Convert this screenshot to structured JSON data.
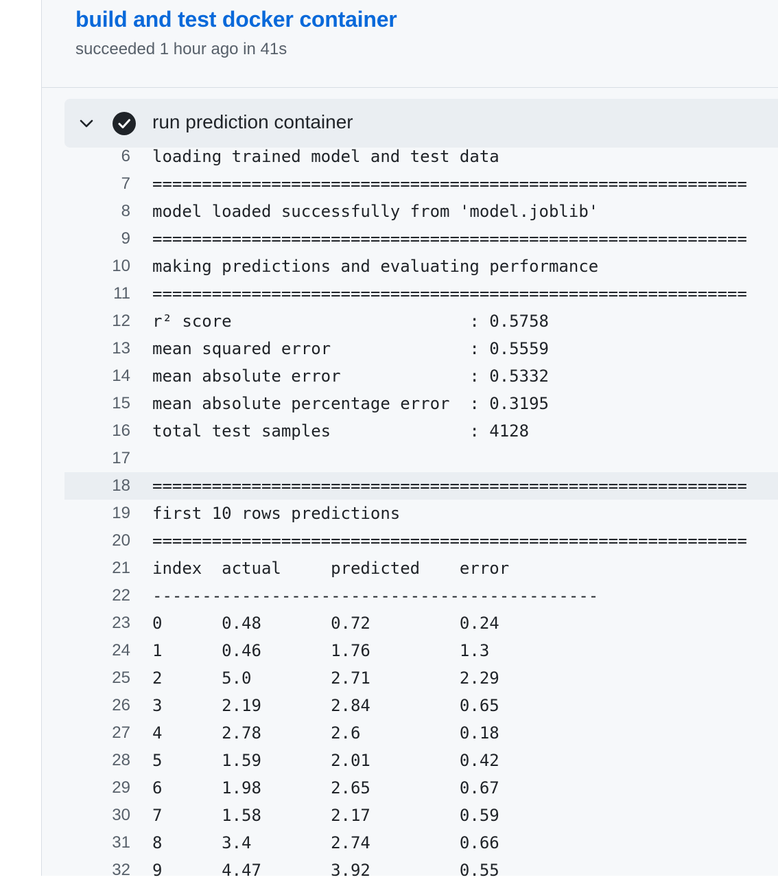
{
  "job": {
    "title": "build and test docker container",
    "status": "succeeded 1 hour ago in 41s"
  },
  "step": {
    "title": "run prediction container",
    "icons": {
      "toggle": "chevron-down-icon",
      "status": "check-circle-icon"
    },
    "status_color": "#1f2328"
  },
  "colors": {
    "link": "#0969da",
    "muted": "#57606a",
    "text": "#1f2328",
    "panel_bg": "#f6f8fa",
    "highlight_bg": "#eaeef2"
  },
  "log": {
    "highlighted_line": "18",
    "lines": [
      {
        "no": "6",
        "text": "loading trained model and test data"
      },
      {
        "no": "7",
        "text": "============================================================"
      },
      {
        "no": "8",
        "text": "model loaded successfully from 'model.joblib'"
      },
      {
        "no": "9",
        "text": "============================================================"
      },
      {
        "no": "10",
        "text": "making predictions and evaluating performance"
      },
      {
        "no": "11",
        "text": "============================================================"
      },
      {
        "no": "12",
        "text": "r² score                        : 0.5758"
      },
      {
        "no": "13",
        "text": "mean squared error              : 0.5559"
      },
      {
        "no": "14",
        "text": "mean absolute error             : 0.5332"
      },
      {
        "no": "15",
        "text": "mean absolute percentage error  : 0.3195"
      },
      {
        "no": "16",
        "text": "total test samples              : 4128"
      },
      {
        "no": "17",
        "text": ""
      },
      {
        "no": "18",
        "text": "============================================================"
      },
      {
        "no": "19",
        "text": "first 10 rows predictions"
      },
      {
        "no": "20",
        "text": "============================================================"
      },
      {
        "no": "21",
        "text": "index  actual     predicted    error"
      },
      {
        "no": "22",
        "text": "---------------------------------------------"
      },
      {
        "no": "23",
        "text": "0      0.48       0.72         0.24"
      },
      {
        "no": "24",
        "text": "1      0.46       1.76         1.3"
      },
      {
        "no": "25",
        "text": "2      5.0        2.71         2.29"
      },
      {
        "no": "26",
        "text": "3      2.19       2.84         0.65"
      },
      {
        "no": "27",
        "text": "4      2.78       2.6          0.18"
      },
      {
        "no": "28",
        "text": "5      1.59       2.01         0.42"
      },
      {
        "no": "29",
        "text": "6      1.98       2.65         0.67"
      },
      {
        "no": "30",
        "text": "7      1.58       2.17         0.59"
      },
      {
        "no": "31",
        "text": "8      3.4        2.74         0.66"
      },
      {
        "no": "32",
        "text": "9      4.47       3.92         0.55"
      }
    ]
  }
}
